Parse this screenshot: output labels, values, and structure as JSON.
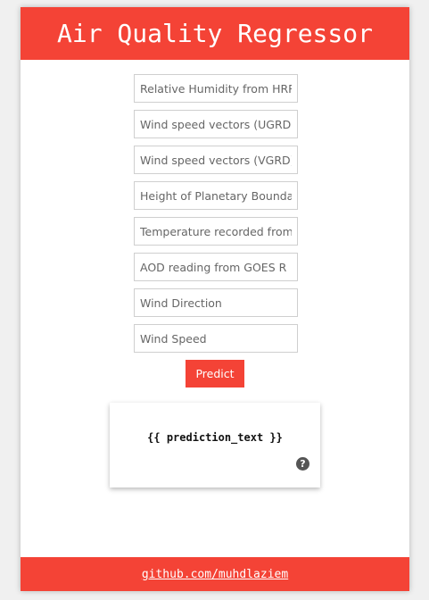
{
  "header": {
    "title": "Air Quality Regressor"
  },
  "form": {
    "fields": [
      {
        "placeholder": "Relative Humidity from HRRR",
        "value": ""
      },
      {
        "placeholder": "Wind speed vectors (UGRD)",
        "value": ""
      },
      {
        "placeholder": "Wind speed vectors (VGRD)",
        "value": ""
      },
      {
        "placeholder": "Height of Planetary Boundary Layer",
        "value": ""
      },
      {
        "placeholder": "Temperature recorded from HRRR",
        "value": ""
      },
      {
        "placeholder": "AOD reading from GOES R",
        "value": ""
      },
      {
        "placeholder": "Wind Direction",
        "value": ""
      },
      {
        "placeholder": "Wind Speed",
        "value": ""
      }
    ],
    "submit_label": "Predict"
  },
  "result": {
    "text": "{{ prediction_text }}",
    "help_icon": "question-circle-icon",
    "help_glyph": "?"
  },
  "footer": {
    "link_text": "github.com/muhdlaziem"
  },
  "colors": {
    "accent": "#f44336",
    "background": "#f0f0f0"
  }
}
